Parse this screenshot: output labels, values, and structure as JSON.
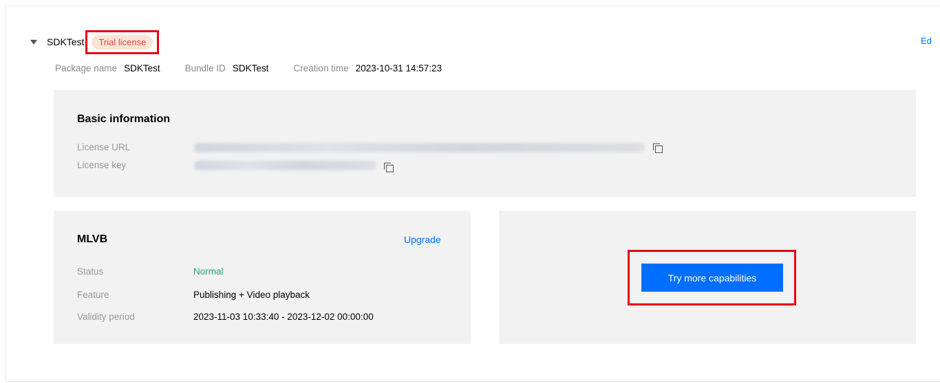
{
  "app": {
    "name": "SDKTest",
    "badge": "Trial license",
    "edit_link": "Ed"
  },
  "meta": [
    {
      "label": "Package name",
      "value": "SDKTest"
    },
    {
      "label": "Bundle ID",
      "value": "SDKTest"
    },
    {
      "label": "Creation time",
      "value": "2023-10-31 14:57:23"
    }
  ],
  "basic_info": {
    "title": "Basic information",
    "license_url_label": "License URL",
    "license_key_label": "License key"
  },
  "mlvb": {
    "title": "MLVB",
    "upgrade_link": "Upgrade",
    "rows": [
      {
        "label": "Status",
        "value": "Normal"
      },
      {
        "label": "Feature",
        "value": "Publishing + Video playback"
      },
      {
        "label": "Validity period",
        "value": "2023-11-03 10:33:40 - 2023-12-02 00:00:00"
      }
    ]
  },
  "try_more": {
    "button_label": "Try more capabilities"
  },
  "colors": {
    "accent": "#006eff",
    "highlight": "#e60012",
    "status_normal": "#2ba471",
    "badge_bg": "#fce4d6",
    "badge_text": "#e54545"
  }
}
